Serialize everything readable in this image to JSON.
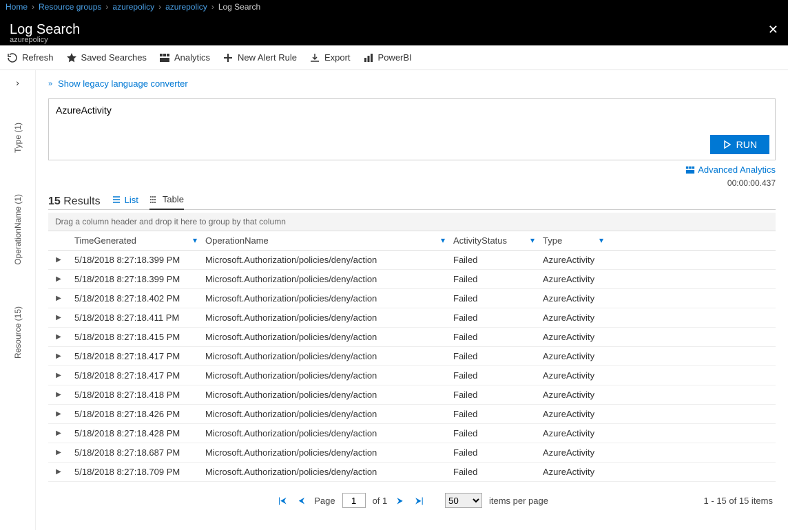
{
  "breadcrumb": {
    "home": "Home",
    "rg": "Resource groups",
    "p1": "azurepolicy",
    "p2": "azurepolicy",
    "cur": "Log Search"
  },
  "titlebar": {
    "title": "Log Search",
    "sub": "azurepolicy"
  },
  "toolbar": {
    "refresh": "Refresh",
    "saved": "Saved Searches",
    "analytics": "Analytics",
    "newrule": "New Alert Rule",
    "export": "Export",
    "powerbi": "PowerBI"
  },
  "sidebar": {
    "type": "Type (1)",
    "opname": "OperationName (1)",
    "resource": "Resource (15)"
  },
  "legacy": "Show legacy language converter",
  "query": "AzureActivity",
  "run": "RUN",
  "advanced": "Advanced Analytics",
  "elapsed": "00:00:00.437",
  "results": {
    "count": "15",
    "label": "Results",
    "list": "List",
    "table": "Table"
  },
  "grouphint": "Drag a column header and drop it here to group by that column",
  "columns": {
    "time": "TimeGenerated",
    "op": "OperationName",
    "stat": "ActivityStatus",
    "type": "Type"
  },
  "rows": [
    {
      "time": "5/18/2018 8:27:18.399 PM",
      "op": "Microsoft.Authorization/policies/deny/action",
      "stat": "Failed",
      "type": "AzureActivity"
    },
    {
      "time": "5/18/2018 8:27:18.399 PM",
      "op": "Microsoft.Authorization/policies/deny/action",
      "stat": "Failed",
      "type": "AzureActivity"
    },
    {
      "time": "5/18/2018 8:27:18.402 PM",
      "op": "Microsoft.Authorization/policies/deny/action",
      "stat": "Failed",
      "type": "AzureActivity"
    },
    {
      "time": "5/18/2018 8:27:18.411 PM",
      "op": "Microsoft.Authorization/policies/deny/action",
      "stat": "Failed",
      "type": "AzureActivity"
    },
    {
      "time": "5/18/2018 8:27:18.415 PM",
      "op": "Microsoft.Authorization/policies/deny/action",
      "stat": "Failed",
      "type": "AzureActivity"
    },
    {
      "time": "5/18/2018 8:27:18.417 PM",
      "op": "Microsoft.Authorization/policies/deny/action",
      "stat": "Failed",
      "type": "AzureActivity"
    },
    {
      "time": "5/18/2018 8:27:18.417 PM",
      "op": "Microsoft.Authorization/policies/deny/action",
      "stat": "Failed",
      "type": "AzureActivity"
    },
    {
      "time": "5/18/2018 8:27:18.418 PM",
      "op": "Microsoft.Authorization/policies/deny/action",
      "stat": "Failed",
      "type": "AzureActivity"
    },
    {
      "time": "5/18/2018 8:27:18.426 PM",
      "op": "Microsoft.Authorization/policies/deny/action",
      "stat": "Failed",
      "type": "AzureActivity"
    },
    {
      "time": "5/18/2018 8:27:18.428 PM",
      "op": "Microsoft.Authorization/policies/deny/action",
      "stat": "Failed",
      "type": "AzureActivity"
    },
    {
      "time": "5/18/2018 8:27:18.687 PM",
      "op": "Microsoft.Authorization/policies/deny/action",
      "stat": "Failed",
      "type": "AzureActivity"
    },
    {
      "time": "5/18/2018 8:27:18.709 PM",
      "op": "Microsoft.Authorization/policies/deny/action",
      "stat": "Failed",
      "type": "AzureActivity"
    }
  ],
  "pager": {
    "pageLabel": "Page",
    "page": "1",
    "of": "of 1",
    "perpage": "50",
    "perpageLabel": "items per page",
    "summary": "1 - 15 of 15 items"
  }
}
